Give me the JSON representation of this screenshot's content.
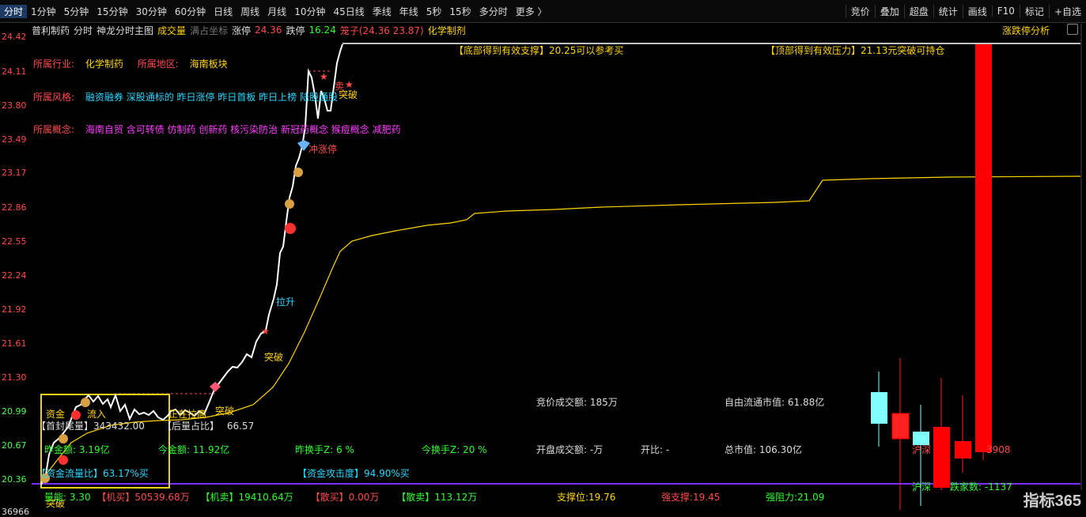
{
  "timeframes": [
    "分时",
    "1分钟",
    "5分钟",
    "15分钟",
    "30分钟",
    "60分钟",
    "日线",
    "周线",
    "月线",
    "10分钟",
    "45日线",
    "季线",
    "年线",
    "5秒",
    "15秒",
    "多分时",
    "更多 〉"
  ],
  "tools": [
    "竞价",
    "叠加",
    "超盘",
    "统计",
    "画线",
    "F10",
    "标记",
    "+自选"
  ],
  "title": {
    "stock": "普利制药",
    "mode": "分时",
    "main": "神龙分时主图",
    "vol": "成交量",
    "coord": "满占坐标",
    "limit_up_label": "涨停",
    "limit_up": "24.36",
    "limit_down_label": "跌停",
    "limit_down": "16.24",
    "cage": "笼子(24.36 23.87)",
    "sector": "化学制剂"
  },
  "right_link": "涨跌停分析",
  "y_labels": [
    "24.42",
    "24.11",
    "23.80",
    "23.49",
    "23.17",
    "22.86",
    "22.55",
    "22.24",
    "21.92",
    "21.61",
    "21.30",
    "20.99",
    "20.67",
    "20.36",
    "36966"
  ],
  "info": {
    "industry_label": "所属行业:",
    "industry": "化学制药",
    "region_label": "所属地区:",
    "region": "海南板块",
    "style_label": "所属风格:",
    "style": "融资融券 深股通标的 昨日涨停 昨日首板 昨日上榜 陆股通股",
    "concept_label": "所属概念:",
    "concept": "海南自贸 含可转债 仿制药 创新药 核污染防治 新冠药概念 猴痘概念 减肥药"
  },
  "support_note": "【底部得到有效支撑】20.25可以参考买",
  "pressure_note": "【顶部得到有效压力】21.13元突破可持仓",
  "annotations": {
    "zijin": "资金",
    "liuru": "流入",
    "zhengzai": "正在拉高",
    "tupo1": "突破",
    "tupo2": "突破",
    "tupo3": "突破",
    "tupo4": "突破",
    "lasheng": "拉升",
    "chongzhangting": "冲涨停",
    "mai": "卖",
    "maixing": "★"
  },
  "stats": {
    "shoufeng_label": "【首封尾量】",
    "shoufeng": "343432.00",
    "houliang_label": "【后量占比】",
    "houliang": "66.57",
    "zuojin_label": "昨金额: ",
    "zuojin": "3.19亿",
    "jinjin_label": "今金额: ",
    "jinjin": "11.92亿",
    "zuohuan_label": "昨换手Z: ",
    "zuohuan": "6 %",
    "jinhuan_label": "今换手Z: ",
    "jinhuan": "20 %",
    "zjll_label": "【资金流量比】",
    "zjll": "63.17%买",
    "zjgj_label": "【资金攻击度】",
    "zjgj": "94.90%买",
    "jjcj_label": "竞价成交额: ",
    "jjcj": "185万",
    "kpcj_label": "开盘成交额: ",
    "kpcj": "-万",
    "kaibi_label": "开比: ",
    "kaibi": "-",
    "ziyou_label": "自由流通市值: ",
    "ziyou": "61.88亿",
    "zong_label": "总市值: ",
    "zong": "106.30亿",
    "hsz_label": "沪深",
    "hsz": "3908",
    "hsz2_label": "沪深",
    "hsz2": "跌家数: -1137",
    "liangbi_label": "量能: ",
    "liangbi": "3.30",
    "jimai_label": "【机买】",
    "jimai": "50539.68万",
    "jimaichu_label": "【机卖】",
    "jimaichu": "19410.64万",
    "sanmai_label": "【散买】",
    "sanmai": "0.00万",
    "sanmaichu_label": "【散卖】",
    "sanmaichu": "113.12万",
    "zhicheng_label": "支撑位:",
    "zhicheng": "19.76",
    "qiangzhi_label": "强支撑:",
    "qiangzhi": "19.45",
    "qiangzu_label": "强阻力:",
    "qiangzu": "21.09"
  },
  "logo": "指标365",
  "colors": {
    "up": "#ff4a4a",
    "down": "#4cff4c",
    "price": "#ffffff",
    "avg": "#ffd400",
    "box": "#e6d21a",
    "purple": "#7a2cff",
    "cyan": "#80ffff"
  }
}
